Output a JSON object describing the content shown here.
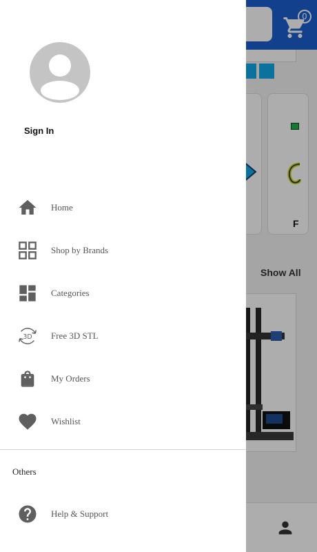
{
  "background": {
    "cart_count": "0",
    "category_partial_label": "F",
    "show_all_label": "Show All"
  },
  "drawer": {
    "sign_in_label": "Sign In",
    "menu": [
      {
        "label": "Home",
        "icon": "home-icon"
      },
      {
        "label": "Shop by Brands",
        "icon": "grid-icon"
      },
      {
        "label": "Categories",
        "icon": "dashboard-icon"
      },
      {
        "label": "Free 3D STL",
        "icon": "3d-rotate-icon"
      },
      {
        "label": "My Orders",
        "icon": "shopping-bag-icon"
      },
      {
        "label": "Wishlist",
        "icon": "heart-icon"
      }
    ],
    "section_others": "Others",
    "help": {
      "label": "Help & Support",
      "icon": "help-icon"
    }
  },
  "colors": {
    "header_blue": "#1d5fd0",
    "accent_cyan": "#0fa9e6",
    "icon_gray": "#5f5f5f",
    "label_gray": "#555555"
  }
}
